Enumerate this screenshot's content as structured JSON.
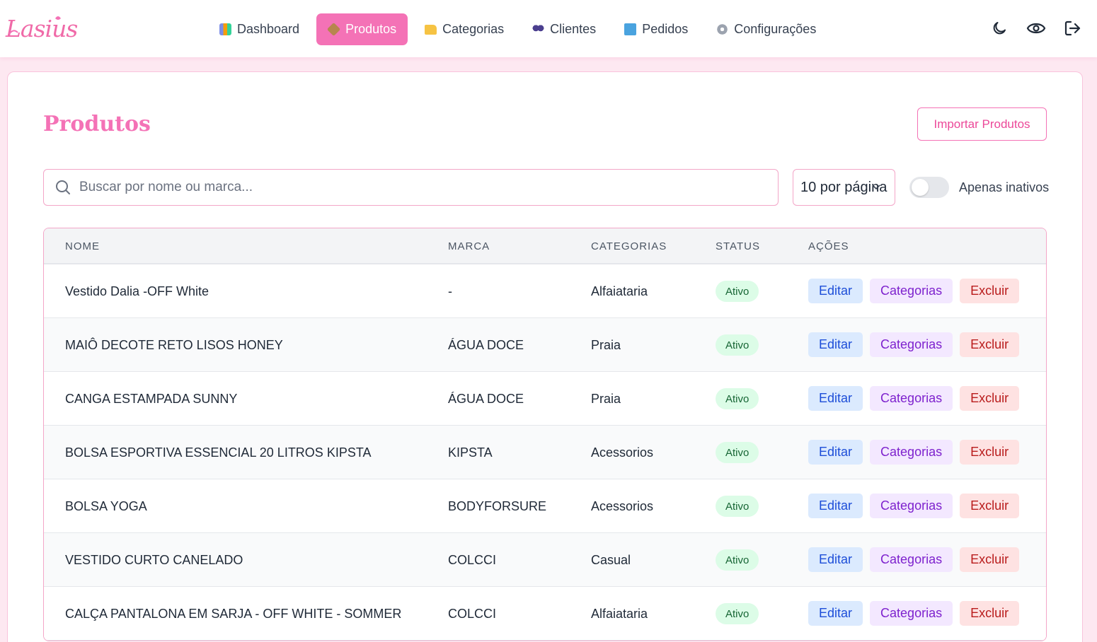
{
  "brand": {
    "logo_text": "Lasius",
    "accent": "#f472b6"
  },
  "nav": {
    "items": [
      {
        "label": "Dashboard",
        "icon": "chart-icon",
        "active": false
      },
      {
        "label": "Produtos",
        "icon": "box-icon",
        "active": true
      },
      {
        "label": "Categorias",
        "icon": "folder-icon",
        "active": false
      },
      {
        "label": "Clientes",
        "icon": "users-icon",
        "active": false
      },
      {
        "label": "Pedidos",
        "icon": "shopping-bag-icon",
        "active": false
      },
      {
        "label": "Configurações",
        "icon": "gear-icon",
        "active": false
      }
    ],
    "right_icons": [
      "moon-icon",
      "eye-icon",
      "logout-icon"
    ]
  },
  "page": {
    "title": "Produtos",
    "import_label": "Importar Produtos",
    "search_placeholder": "Buscar por nome ou marca...",
    "per_page_label": "10 por página",
    "inactive_label": "Apenas inativos"
  },
  "table": {
    "headers": {
      "nome": "NOME",
      "marca": "MARCA",
      "categorias": "CATEGORIAS",
      "status": "STATUS",
      "acoes": "AÇÕES"
    },
    "action_labels": {
      "edit": "Editar",
      "categories": "Categorias",
      "delete": "Excluir"
    },
    "rows": [
      {
        "nome": "Vestido Dalia -OFF White",
        "marca": "-",
        "categoria": "Alfaiataria",
        "status": "Ativo"
      },
      {
        "nome": "MAIÔ DECOTE RETO LISOS HONEY",
        "marca": "ÁGUA DOCE",
        "categoria": "Praia",
        "status": "Ativo"
      },
      {
        "nome": "CANGA ESTAMPADA SUNNY",
        "marca": "ÁGUA DOCE",
        "categoria": "Praia",
        "status": "Ativo"
      },
      {
        "nome": "BOLSA ESPORTIVA ESSENCIAL 20 LITROS KIPSTA",
        "marca": "KIPSTA",
        "categoria": "Acessorios",
        "status": "Ativo"
      },
      {
        "nome": "BOLSA YOGA",
        "marca": "BODYFORSURE",
        "categoria": "Acessorios",
        "status": "Ativo"
      },
      {
        "nome": "VESTIDO CURTO CANELADO",
        "marca": "COLCCI",
        "categoria": "Casual",
        "status": "Ativo"
      },
      {
        "nome": "CALÇA PANTALONA EM SARJA - OFF WHITE - SOMMER",
        "marca": "COLCCI",
        "categoria": "Alfaiataria",
        "status": "Ativo"
      }
    ]
  }
}
